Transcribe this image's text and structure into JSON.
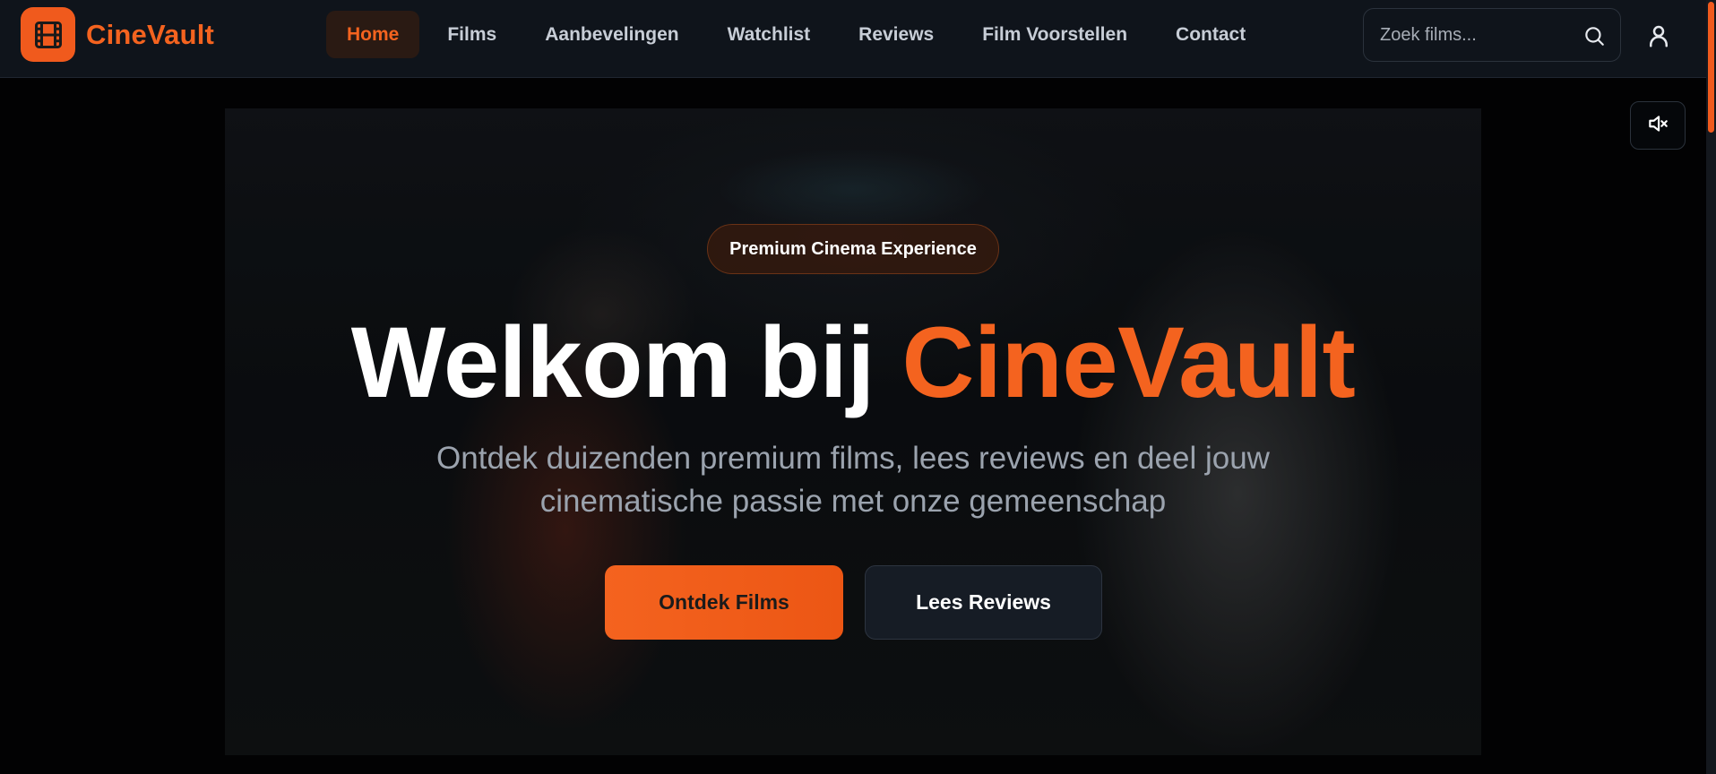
{
  "brand": {
    "name": "CineVault",
    "logo_icon": "film-icon",
    "accent_color": "#f4631f"
  },
  "nav": {
    "items": [
      {
        "label": "Home",
        "active": true
      },
      {
        "label": "Films",
        "active": false
      },
      {
        "label": "Aanbevelingen",
        "active": false
      },
      {
        "label": "Watchlist",
        "active": false
      },
      {
        "label": "Reviews",
        "active": false
      },
      {
        "label": "Film Voorstellen",
        "active": false
      },
      {
        "label": "Contact",
        "active": false
      }
    ]
  },
  "search": {
    "placeholder": "Zoek films...",
    "value": "",
    "icon": "search-icon"
  },
  "user": {
    "icon": "user-icon"
  },
  "hero": {
    "mute_icon": "volume-muted-icon",
    "badge": "Premium Cinema Experience",
    "title_prefix": "Welkom bij ",
    "title_accent": "CineVault",
    "subtitle": "Ontdek duizenden premium films, lees reviews en deel jouw cinematische passie met onze gemeenschap",
    "primary_button": "Ontdek Films",
    "secondary_button": "Lees Reviews"
  }
}
